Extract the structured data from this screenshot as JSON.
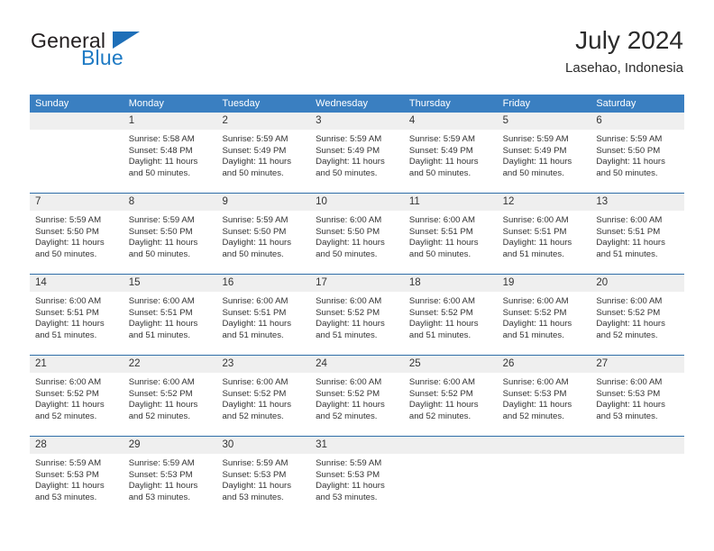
{
  "brand": {
    "name_top": "General",
    "name_bottom": "Blue",
    "flag_color": "#1e6fb8",
    "blue_color": "#1e7ac4"
  },
  "header": {
    "title": "July 2024",
    "subtitle": "Lasehao, Indonesia"
  },
  "theme": {
    "header_blue": "#3a7fc1",
    "divider_blue": "#2f6ea8",
    "day_band_gray": "#efefef"
  },
  "weekdays": [
    "Sunday",
    "Monday",
    "Tuesday",
    "Wednesday",
    "Thursday",
    "Friday",
    "Saturday"
  ],
  "weeks": [
    [
      {
        "empty": true
      },
      {
        "day": "1",
        "sunrise": "Sunrise: 5:58 AM",
        "sunset": "Sunset: 5:48 PM",
        "daylight1": "Daylight: 11 hours",
        "daylight2": "and 50 minutes."
      },
      {
        "day": "2",
        "sunrise": "Sunrise: 5:59 AM",
        "sunset": "Sunset: 5:49 PM",
        "daylight1": "Daylight: 11 hours",
        "daylight2": "and 50 minutes."
      },
      {
        "day": "3",
        "sunrise": "Sunrise: 5:59 AM",
        "sunset": "Sunset: 5:49 PM",
        "daylight1": "Daylight: 11 hours",
        "daylight2": "and 50 minutes."
      },
      {
        "day": "4",
        "sunrise": "Sunrise: 5:59 AM",
        "sunset": "Sunset: 5:49 PM",
        "daylight1": "Daylight: 11 hours",
        "daylight2": "and 50 minutes."
      },
      {
        "day": "5",
        "sunrise": "Sunrise: 5:59 AM",
        "sunset": "Sunset: 5:49 PM",
        "daylight1": "Daylight: 11 hours",
        "daylight2": "and 50 minutes."
      },
      {
        "day": "6",
        "sunrise": "Sunrise: 5:59 AM",
        "sunset": "Sunset: 5:50 PM",
        "daylight1": "Daylight: 11 hours",
        "daylight2": "and 50 minutes."
      }
    ],
    [
      {
        "day": "7",
        "sunrise": "Sunrise: 5:59 AM",
        "sunset": "Sunset: 5:50 PM",
        "daylight1": "Daylight: 11 hours",
        "daylight2": "and 50 minutes."
      },
      {
        "day": "8",
        "sunrise": "Sunrise: 5:59 AM",
        "sunset": "Sunset: 5:50 PM",
        "daylight1": "Daylight: 11 hours",
        "daylight2": "and 50 minutes."
      },
      {
        "day": "9",
        "sunrise": "Sunrise: 5:59 AM",
        "sunset": "Sunset: 5:50 PM",
        "daylight1": "Daylight: 11 hours",
        "daylight2": "and 50 minutes."
      },
      {
        "day": "10",
        "sunrise": "Sunrise: 6:00 AM",
        "sunset": "Sunset: 5:50 PM",
        "daylight1": "Daylight: 11 hours",
        "daylight2": "and 50 minutes."
      },
      {
        "day": "11",
        "sunrise": "Sunrise: 6:00 AM",
        "sunset": "Sunset: 5:51 PM",
        "daylight1": "Daylight: 11 hours",
        "daylight2": "and 50 minutes."
      },
      {
        "day": "12",
        "sunrise": "Sunrise: 6:00 AM",
        "sunset": "Sunset: 5:51 PM",
        "daylight1": "Daylight: 11 hours",
        "daylight2": "and 51 minutes."
      },
      {
        "day": "13",
        "sunrise": "Sunrise: 6:00 AM",
        "sunset": "Sunset: 5:51 PM",
        "daylight1": "Daylight: 11 hours",
        "daylight2": "and 51 minutes."
      }
    ],
    [
      {
        "day": "14",
        "sunrise": "Sunrise: 6:00 AM",
        "sunset": "Sunset: 5:51 PM",
        "daylight1": "Daylight: 11 hours",
        "daylight2": "and 51 minutes."
      },
      {
        "day": "15",
        "sunrise": "Sunrise: 6:00 AM",
        "sunset": "Sunset: 5:51 PM",
        "daylight1": "Daylight: 11 hours",
        "daylight2": "and 51 minutes."
      },
      {
        "day": "16",
        "sunrise": "Sunrise: 6:00 AM",
        "sunset": "Sunset: 5:51 PM",
        "daylight1": "Daylight: 11 hours",
        "daylight2": "and 51 minutes."
      },
      {
        "day": "17",
        "sunrise": "Sunrise: 6:00 AM",
        "sunset": "Sunset: 5:52 PM",
        "daylight1": "Daylight: 11 hours",
        "daylight2": "and 51 minutes."
      },
      {
        "day": "18",
        "sunrise": "Sunrise: 6:00 AM",
        "sunset": "Sunset: 5:52 PM",
        "daylight1": "Daylight: 11 hours",
        "daylight2": "and 51 minutes."
      },
      {
        "day": "19",
        "sunrise": "Sunrise: 6:00 AM",
        "sunset": "Sunset: 5:52 PM",
        "daylight1": "Daylight: 11 hours",
        "daylight2": "and 51 minutes."
      },
      {
        "day": "20",
        "sunrise": "Sunrise: 6:00 AM",
        "sunset": "Sunset: 5:52 PM",
        "daylight1": "Daylight: 11 hours",
        "daylight2": "and 52 minutes."
      }
    ],
    [
      {
        "day": "21",
        "sunrise": "Sunrise: 6:00 AM",
        "sunset": "Sunset: 5:52 PM",
        "daylight1": "Daylight: 11 hours",
        "daylight2": "and 52 minutes."
      },
      {
        "day": "22",
        "sunrise": "Sunrise: 6:00 AM",
        "sunset": "Sunset: 5:52 PM",
        "daylight1": "Daylight: 11 hours",
        "daylight2": "and 52 minutes."
      },
      {
        "day": "23",
        "sunrise": "Sunrise: 6:00 AM",
        "sunset": "Sunset: 5:52 PM",
        "daylight1": "Daylight: 11 hours",
        "daylight2": "and 52 minutes."
      },
      {
        "day": "24",
        "sunrise": "Sunrise: 6:00 AM",
        "sunset": "Sunset: 5:52 PM",
        "daylight1": "Daylight: 11 hours",
        "daylight2": "and 52 minutes."
      },
      {
        "day": "25",
        "sunrise": "Sunrise: 6:00 AM",
        "sunset": "Sunset: 5:52 PM",
        "daylight1": "Daylight: 11 hours",
        "daylight2": "and 52 minutes."
      },
      {
        "day": "26",
        "sunrise": "Sunrise: 6:00 AM",
        "sunset": "Sunset: 5:53 PM",
        "daylight1": "Daylight: 11 hours",
        "daylight2": "and 52 minutes."
      },
      {
        "day": "27",
        "sunrise": "Sunrise: 6:00 AM",
        "sunset": "Sunset: 5:53 PM",
        "daylight1": "Daylight: 11 hours",
        "daylight2": "and 53 minutes."
      }
    ],
    [
      {
        "day": "28",
        "sunrise": "Sunrise: 5:59 AM",
        "sunset": "Sunset: 5:53 PM",
        "daylight1": "Daylight: 11 hours",
        "daylight2": "and 53 minutes."
      },
      {
        "day": "29",
        "sunrise": "Sunrise: 5:59 AM",
        "sunset": "Sunset: 5:53 PM",
        "daylight1": "Daylight: 11 hours",
        "daylight2": "and 53 minutes."
      },
      {
        "day": "30",
        "sunrise": "Sunrise: 5:59 AM",
        "sunset": "Sunset: 5:53 PM",
        "daylight1": "Daylight: 11 hours",
        "daylight2": "and 53 minutes."
      },
      {
        "day": "31",
        "sunrise": "Sunrise: 5:59 AM",
        "sunset": "Sunset: 5:53 PM",
        "daylight1": "Daylight: 11 hours",
        "daylight2": "and 53 minutes."
      },
      {
        "empty": true
      },
      {
        "empty": true
      },
      {
        "empty": true
      }
    ]
  ]
}
